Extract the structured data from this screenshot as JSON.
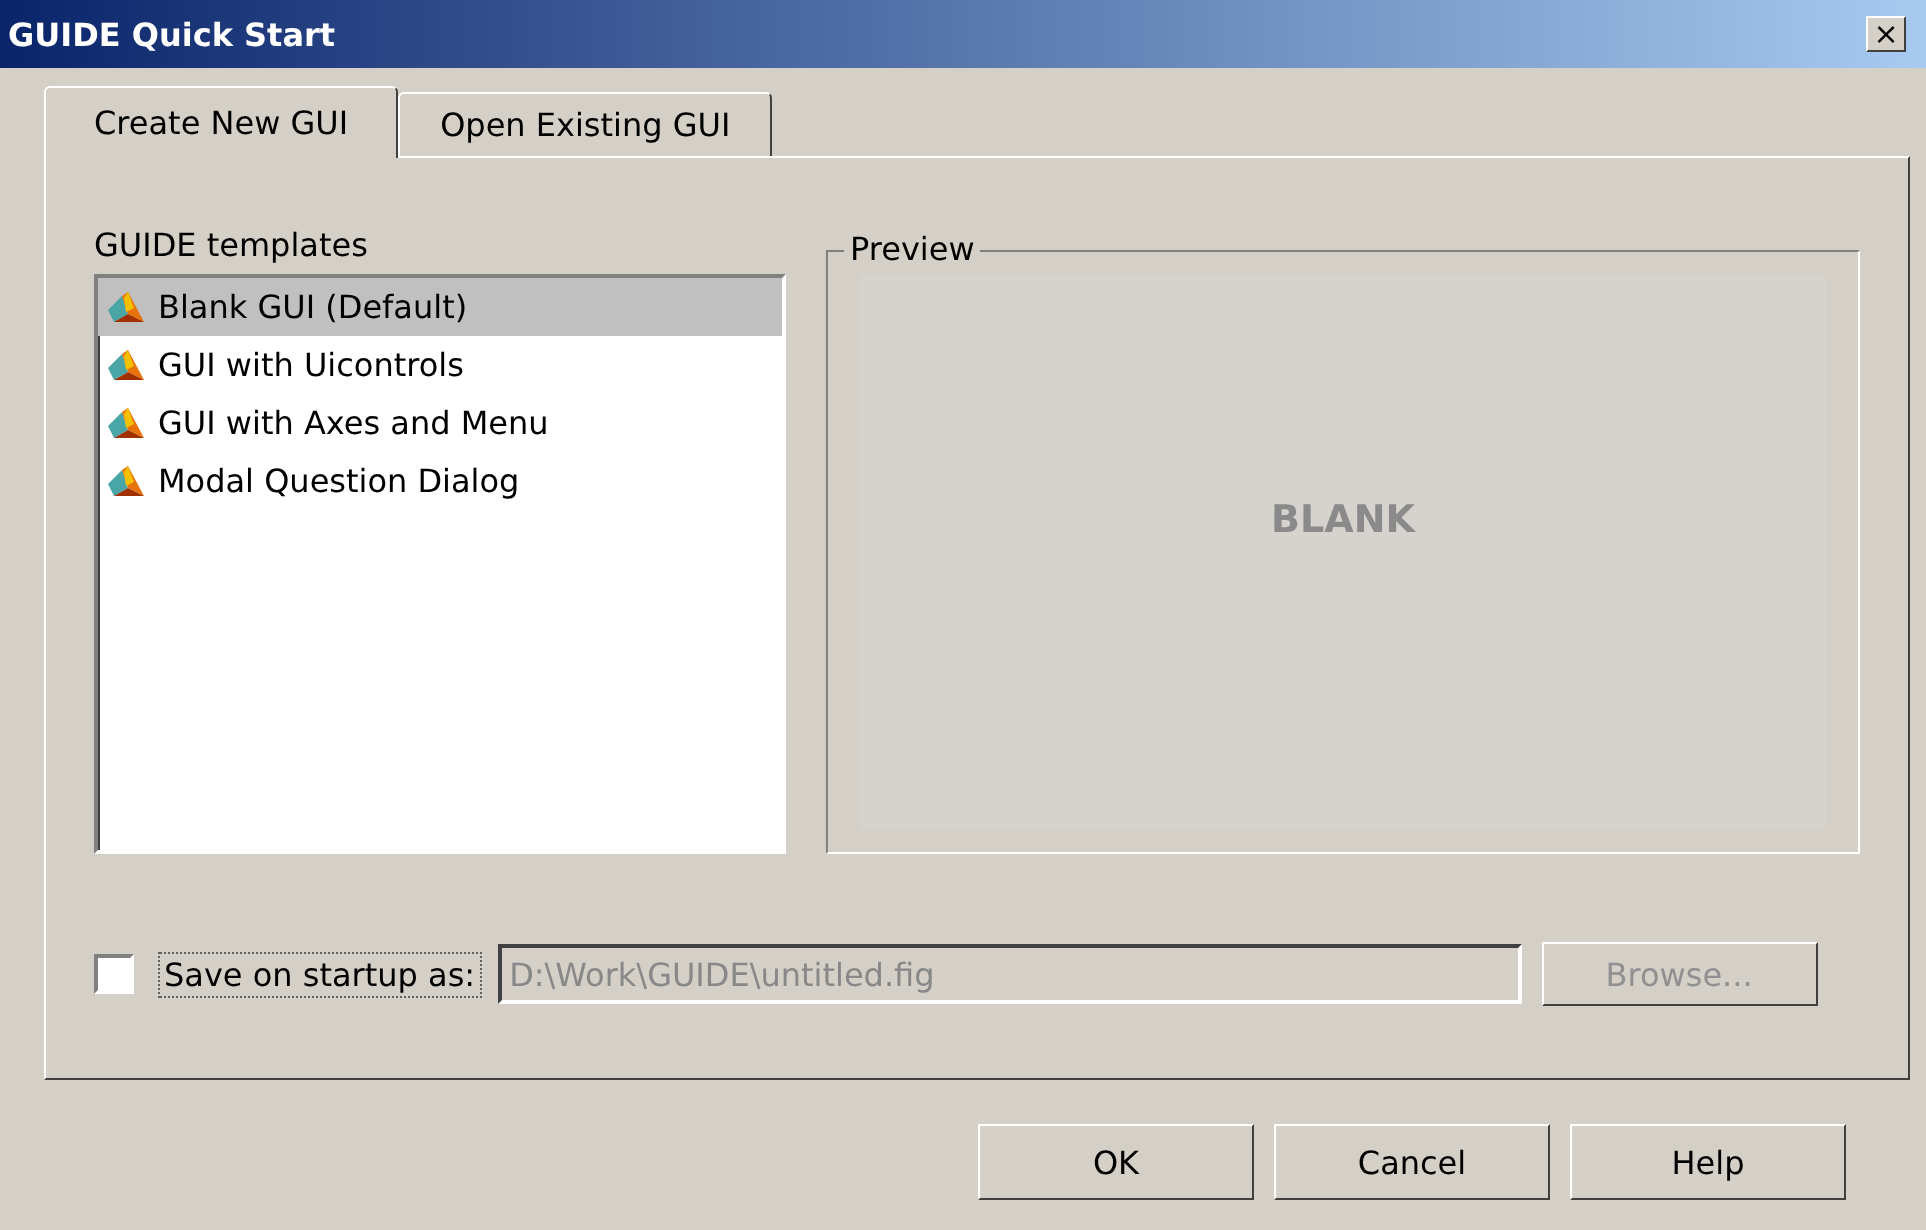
{
  "window": {
    "title": "GUIDE Quick Start",
    "close": "×"
  },
  "tabs": [
    {
      "label": "Create New GUI",
      "selected": true
    },
    {
      "label": "Open Existing GUI",
      "selected": false
    }
  ],
  "templates": {
    "label": "GUIDE templates",
    "items": [
      {
        "label": "Blank GUI (Default)",
        "selected": true
      },
      {
        "label": "GUI with Uicontrols",
        "selected": false
      },
      {
        "label": "GUI with Axes and Menu",
        "selected": false
      },
      {
        "label": "Modal Question Dialog",
        "selected": false
      }
    ]
  },
  "preview": {
    "label": "Preview",
    "text": "BLANK"
  },
  "save": {
    "label": "Save on startup as:",
    "checked": false,
    "value": "D:\\Work\\GUIDE\\untitled.fig",
    "browse": "Browse...",
    "disabled": true
  },
  "buttons": [
    "OK",
    "Cancel",
    "Help"
  ]
}
